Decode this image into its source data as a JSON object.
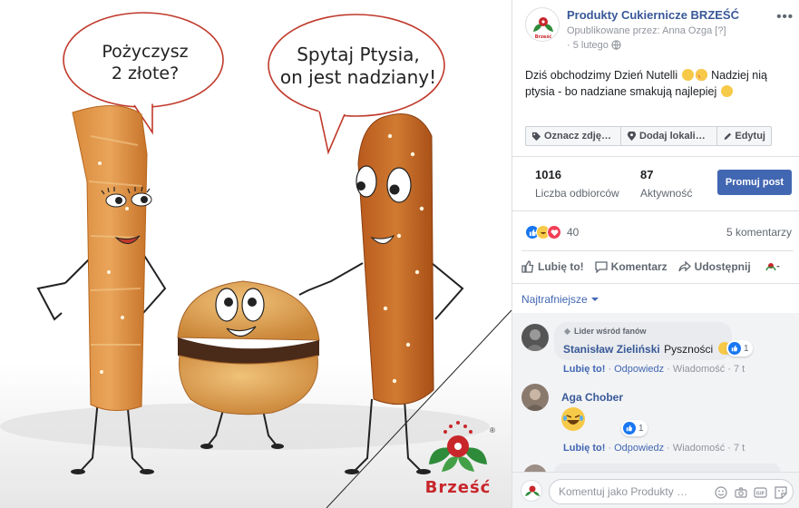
{
  "image": {
    "bubble_left": [
      "Pożyczysz",
      "2 złote?"
    ],
    "bubble_right": [
      "Spytaj Ptysia,",
      "on jest nadziany!"
    ],
    "brand_logo_text": "Brześć"
  },
  "post": {
    "page_name": "Produkty Cukiernicze BRZEŚĆ",
    "byline": "Opublikowane przez: Anna Ozga",
    "byline_help": "[?]",
    "date": "5 lutego",
    "text_line1": "Dziś obchodzimy Dzień Nutelli",
    "text_line1_after": "Nadziej nią",
    "text_line2": "ptysia - bo nadziane smakują najlepiej",
    "more_icon": "more-dots-icon"
  },
  "tag_buttons": [
    {
      "label": "Oznacz zdję…",
      "icon": "tag-icon"
    },
    {
      "label": "Dodaj lokali…",
      "icon": "location-pin-icon"
    },
    {
      "label": "Edytuj",
      "icon": "pencil-icon"
    }
  ],
  "stats": {
    "reach_value": "1016",
    "reach_label": "Liczba odbiorców",
    "engagement_value": "87",
    "engagement_label": "Aktywność",
    "promote_label": "Promuj post"
  },
  "reactions": {
    "count": "40",
    "types": [
      "like",
      "haha",
      "love"
    ],
    "comments_label": "5 komentarzy"
  },
  "actions": {
    "like": "Lubię to!",
    "comment": "Komentarz",
    "share": "Udostępnij"
  },
  "sort": {
    "label": "Najtrafniejsze"
  },
  "comments": [
    {
      "badge": "Lider wśród fanów",
      "author": "Stanisław Zieliński",
      "text": "Pyszności",
      "likes": "1",
      "meta_like": "Lubię to!",
      "meta_reply": "Odpowiedz",
      "meta_msg": "Wiadomość",
      "meta_time": "7 t"
    },
    {
      "author": "Aga Chober",
      "likes": "1",
      "meta_like": "Lubię to!",
      "meta_reply": "Odpowiedz",
      "meta_msg": "Wiadomość",
      "meta_time": "7 t"
    }
  ],
  "compose": {
    "placeholder": "Komentuj jako Produkty …"
  },
  "colors": {
    "link_blue": "#385898",
    "button_blue": "#4267b2",
    "brand_red": "#c8262b",
    "brand_green": "#2e8b3a"
  }
}
